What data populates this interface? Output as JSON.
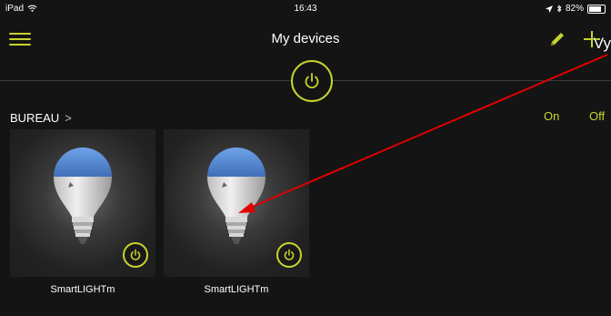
{
  "status_bar": {
    "device": "iPad",
    "time": "16:43",
    "battery": "82%",
    "battery_level": 0.82
  },
  "nav": {
    "title": "My devices",
    "overlay_text": "Vy"
  },
  "group": {
    "name": "BUREAU",
    "chevron": ">",
    "on_label": "On",
    "off_label": "Off"
  },
  "devices": [
    {
      "name": "SmartLIGHTm",
      "power": "on"
    },
    {
      "name": "SmartLIGHTm",
      "power": "on"
    }
  ],
  "colors": {
    "accent": "#c8d42d",
    "background": "#141414",
    "tile": "#1e1e1e",
    "bulb_top": "#4a7fc8",
    "annotation_arrow": "#e00000"
  }
}
